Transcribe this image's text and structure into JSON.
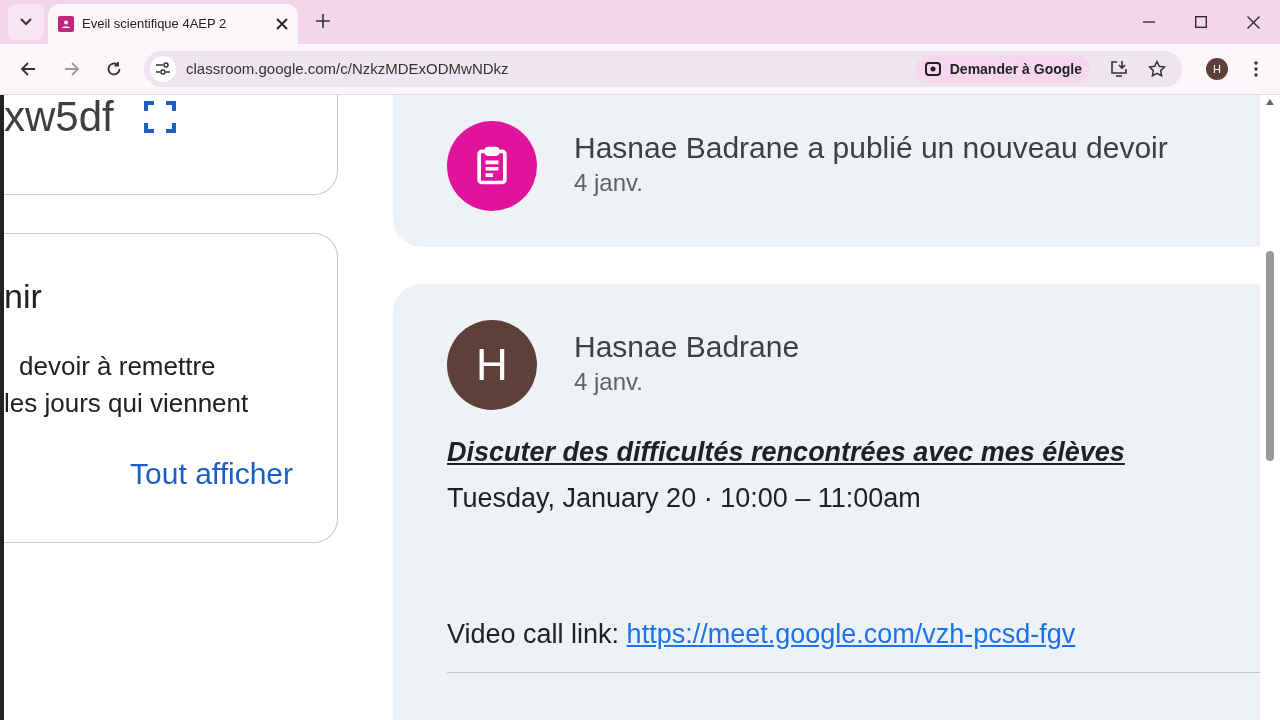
{
  "browser": {
    "tab": {
      "title": "Eveil scientifique 4AEP 2",
      "selected": true
    },
    "url": "classroom.google.com/c/NzkzMDExODMwNDkz",
    "ask_google": "Demander à Google",
    "profile_initial": "H"
  },
  "class_code": {
    "code": "xw5df"
  },
  "upcoming": {
    "title": "nir",
    "lines": [
      "devoir à remettre",
      "les jours qui viennent"
    ],
    "link": "Tout afficher"
  },
  "feed": [
    {
      "kind": "assignment",
      "title": "Hasnae Badrane a publié un nouveau devoir",
      "date": "4 janv."
    },
    {
      "kind": "post",
      "author_initial": "H",
      "title": "Hasnae Badrane",
      "date": "4 janv.",
      "heading": "Discuter des difficultés rencontrées avec mes élèves",
      "when": "Tuesday, January 20 · 10:00 – 11:00am",
      "link_label": "Video call link: ",
      "link": "https://meet.google.com/vzh-pcsd-fgv"
    }
  ]
}
